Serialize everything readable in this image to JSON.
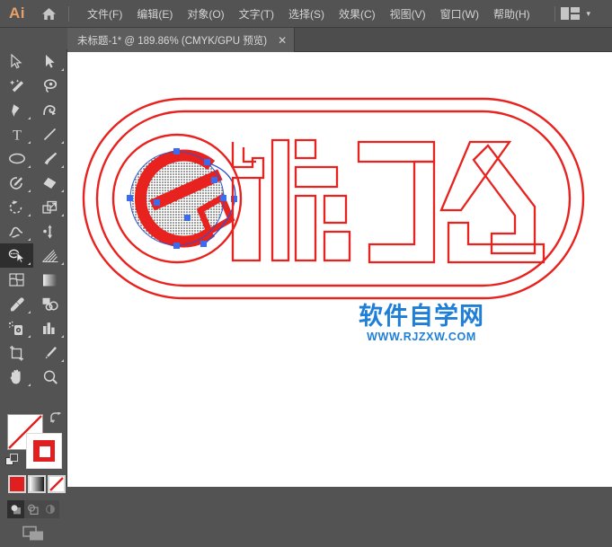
{
  "app": {
    "name": "Ai",
    "logo_color": "#e8a168",
    "bg": "#535353"
  },
  "menubar": {
    "home_icon": "home-icon",
    "items": [
      {
        "label": "文件(F)"
      },
      {
        "label": "编辑(E)"
      },
      {
        "label": "对象(O)"
      },
      {
        "label": "文字(T)"
      },
      {
        "label": "选择(S)"
      },
      {
        "label": "效果(C)"
      },
      {
        "label": "视图(V)"
      },
      {
        "label": "窗口(W)"
      },
      {
        "label": "帮助(H)"
      }
    ],
    "arrange_icon": "arrange-documents-icon",
    "chevron": "▾"
  },
  "tabbar": {
    "collapse_arrows": "«",
    "tabs": [
      {
        "title": "未标题-1* @ 189.86% (CMYK/GPU 预览)",
        "close": "✕",
        "active": true
      }
    ]
  },
  "toolbar": {
    "tools": [
      {
        "name": "selection-tool",
        "has_corner": false,
        "selected": false
      },
      {
        "name": "direct-selection-tool",
        "has_corner": true,
        "selected": false
      },
      {
        "name": "magic-wand-tool",
        "has_corner": false,
        "selected": false
      },
      {
        "name": "lasso-tool",
        "has_corner": false,
        "selected": false
      },
      {
        "name": "pen-tool",
        "has_corner": true,
        "selected": false
      },
      {
        "name": "curvature-tool",
        "has_corner": false,
        "selected": false
      },
      {
        "name": "type-tool",
        "has_corner": true,
        "selected": false
      },
      {
        "name": "line-segment-tool",
        "has_corner": true,
        "selected": false
      },
      {
        "name": "ellipse-tool",
        "has_corner": true,
        "selected": false
      },
      {
        "name": "paintbrush-tool",
        "has_corner": true,
        "selected": false
      },
      {
        "name": "shaper-tool",
        "has_corner": true,
        "selected": false
      },
      {
        "name": "eraser-tool",
        "has_corner": true,
        "selected": false
      },
      {
        "name": "rotate-tool",
        "has_corner": true,
        "selected": false
      },
      {
        "name": "scale-tool",
        "has_corner": true,
        "selected": false
      },
      {
        "name": "width-tool",
        "has_corner": true,
        "selected": false
      },
      {
        "name": "free-transform-tool",
        "has_corner": false,
        "selected": false
      },
      {
        "name": "shape-builder-tool",
        "has_corner": true,
        "selected": true
      },
      {
        "name": "perspective-grid-tool",
        "has_corner": true,
        "selected": false
      },
      {
        "name": "mesh-tool",
        "has_corner": false,
        "selected": false
      },
      {
        "name": "gradient-tool",
        "has_corner": false,
        "selected": false
      },
      {
        "name": "eyedropper-tool",
        "has_corner": true,
        "selected": false
      },
      {
        "name": "blend-tool",
        "has_corner": false,
        "selected": false
      },
      {
        "name": "symbol-sprayer-tool",
        "has_corner": true,
        "selected": false
      },
      {
        "name": "column-graph-tool",
        "has_corner": true,
        "selected": false
      },
      {
        "name": "artboard-tool",
        "has_corner": false,
        "selected": false
      },
      {
        "name": "slice-tool",
        "has_corner": true,
        "selected": false
      },
      {
        "name": "hand-tool",
        "has_corner": true,
        "selected": false
      },
      {
        "name": "zoom-tool",
        "has_corner": false,
        "selected": false
      }
    ],
    "fill": {
      "name": "fill-swatch",
      "value": "none",
      "color": "#ffffff"
    },
    "stroke": {
      "name": "stroke-swatch",
      "color": "#e02020"
    },
    "swap_icon": "swap-fill-stroke-icon",
    "default_icon": "default-fill-stroke-icon",
    "color_modes": [
      {
        "name": "color-mode-solid",
        "color": "#e02020",
        "active": false
      },
      {
        "name": "color-mode-gradient",
        "active": false
      },
      {
        "name": "color-mode-none",
        "active": true
      }
    ],
    "draw_modes": [
      {
        "name": "draw-normal-mode",
        "active": true
      },
      {
        "name": "draw-behind-mode",
        "active": false
      },
      {
        "name": "draw-inside-mode",
        "active": false
      }
    ],
    "screen_mode": {
      "name": "change-screen-mode-button"
    }
  },
  "canvas": {
    "background": "#ffffff",
    "artwork_name": "eleme-logo-outline",
    "stroke_color": "#e8221f",
    "selection_color": "#2d53d0",
    "anchor_color": "#3a6bf0",
    "description": "饿了么 logo outlined paths inside two concentric rounded rectangles"
  },
  "watermark": {
    "cn": "软件自学网",
    "en": "WWW.RJZXW.COM",
    "color": "#1f7fd6"
  }
}
